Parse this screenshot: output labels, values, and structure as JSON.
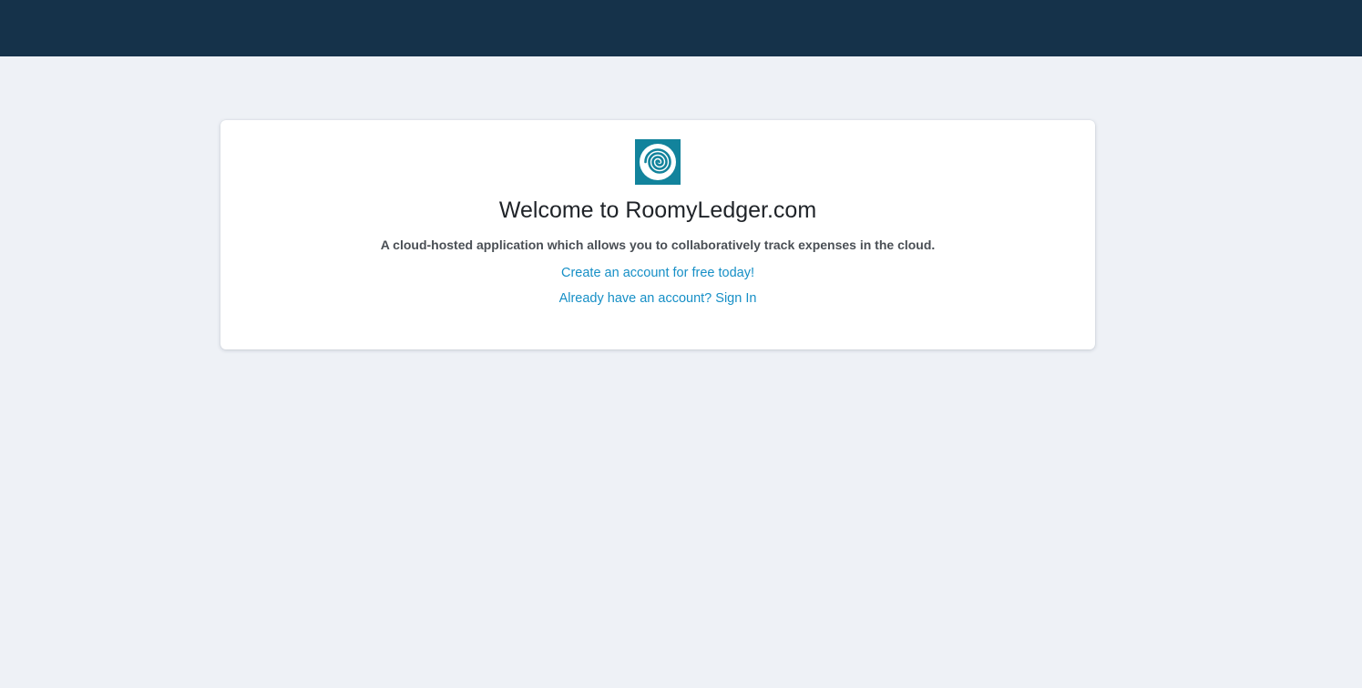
{
  "header": {
    "background": "#15324a"
  },
  "welcome_card": {
    "logo": {
      "icon": "spiral-icon",
      "background": "#12839c"
    },
    "title": "Welcome to RoomyLedger.com",
    "subtitle": "A cloud-hosted application which allows you to collaboratively track expenses in the cloud.",
    "create_account_link": "Create an account for free today!",
    "sign_in_link": "Already have an account? Sign In"
  },
  "colors": {
    "page_background": "#eef1f6",
    "link": "#168fc6"
  }
}
